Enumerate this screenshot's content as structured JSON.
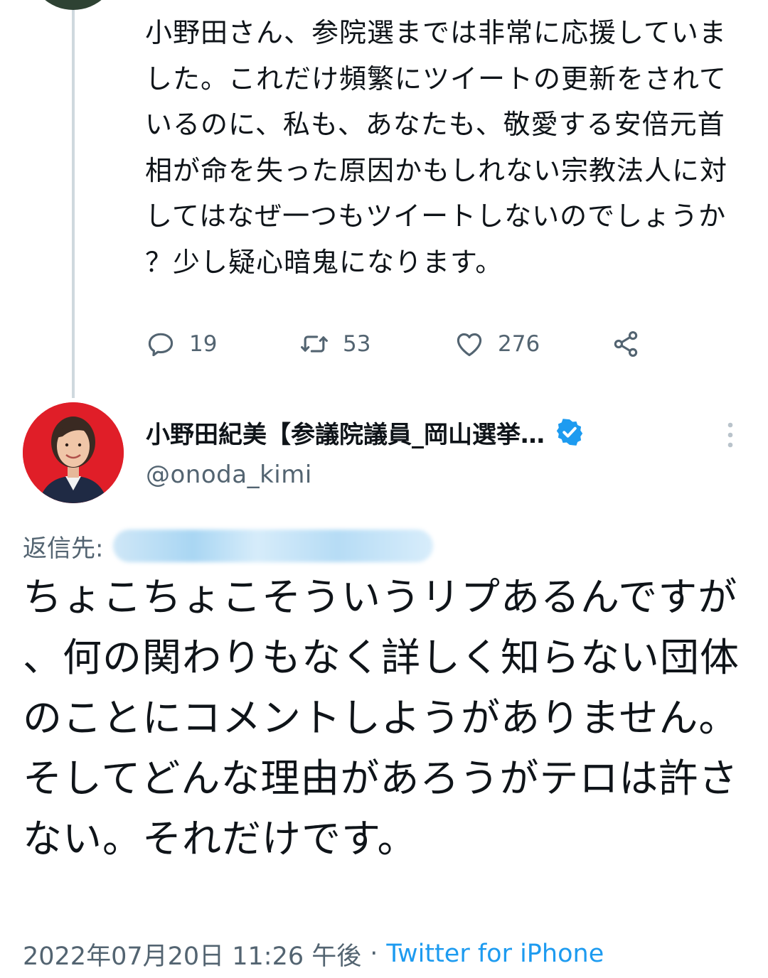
{
  "parent_tweet": {
    "text": "小野田さん、参院選までは非常に応援していました。これだけ頻繁にツイートの更新をされているのに、私も、あなたも、敬愛する安倍元首相が命を失った原因かもしれない宗教法人に対してはなぜ一つもツイートしないのでしょうか？少し疑心暗鬼になります。",
    "actions": {
      "reply_icon": "reply-icon",
      "reply_count": "19",
      "retweet_icon": "retweet-icon",
      "retweet_count": "53",
      "like_icon": "heart-icon",
      "like_count": "276",
      "share_icon": "share-icon"
    }
  },
  "reply_tweet": {
    "avatar_icon": "avatar",
    "display_name": "小野田紀美【参議院議員_岡山選挙…",
    "verified_icon": "verified-badge-icon",
    "more_icon": "more-vertical-icon",
    "handle": "@onoda_kimi",
    "replying_to_label": "返信先:",
    "text": "ちょこちょこそういうリプあるんですが、何の関わりもなく詳しく知らない団体のことにコメントしようがありません。そしてどんな理由があろうがテロは許さない。それだけです。",
    "timestamp": "2022年07月20日 11:26 午後",
    "separator": "·",
    "source": "Twitter for iPhone"
  },
  "colors": {
    "text_primary": "#0f1419",
    "text_secondary": "#536471",
    "link": "#1d9bf0",
    "verified": "#1d9bf0",
    "avatar_bg": "#e01e28",
    "thread_line": "#cfd9de"
  }
}
